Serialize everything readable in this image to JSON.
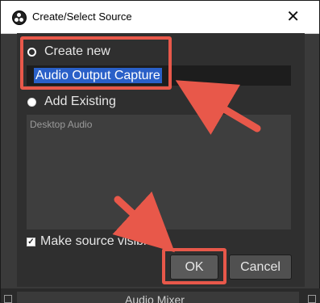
{
  "window": {
    "title": "Create/Select Source",
    "close_icon": "close-icon"
  },
  "form": {
    "create_new_label": "Create new",
    "name_value": "Audio Output Capture",
    "add_existing_label": "Add Existing",
    "existing_sources": [
      "Desktop Audio"
    ],
    "make_visible_label": "Make source visible",
    "make_visible_checked": true
  },
  "buttons": {
    "ok": "OK",
    "cancel": "Cancel"
  },
  "background_panel": {
    "title": "Audio Mixer"
  },
  "annotation_color": "#e8584a",
  "selection_color": "#2a60c8"
}
